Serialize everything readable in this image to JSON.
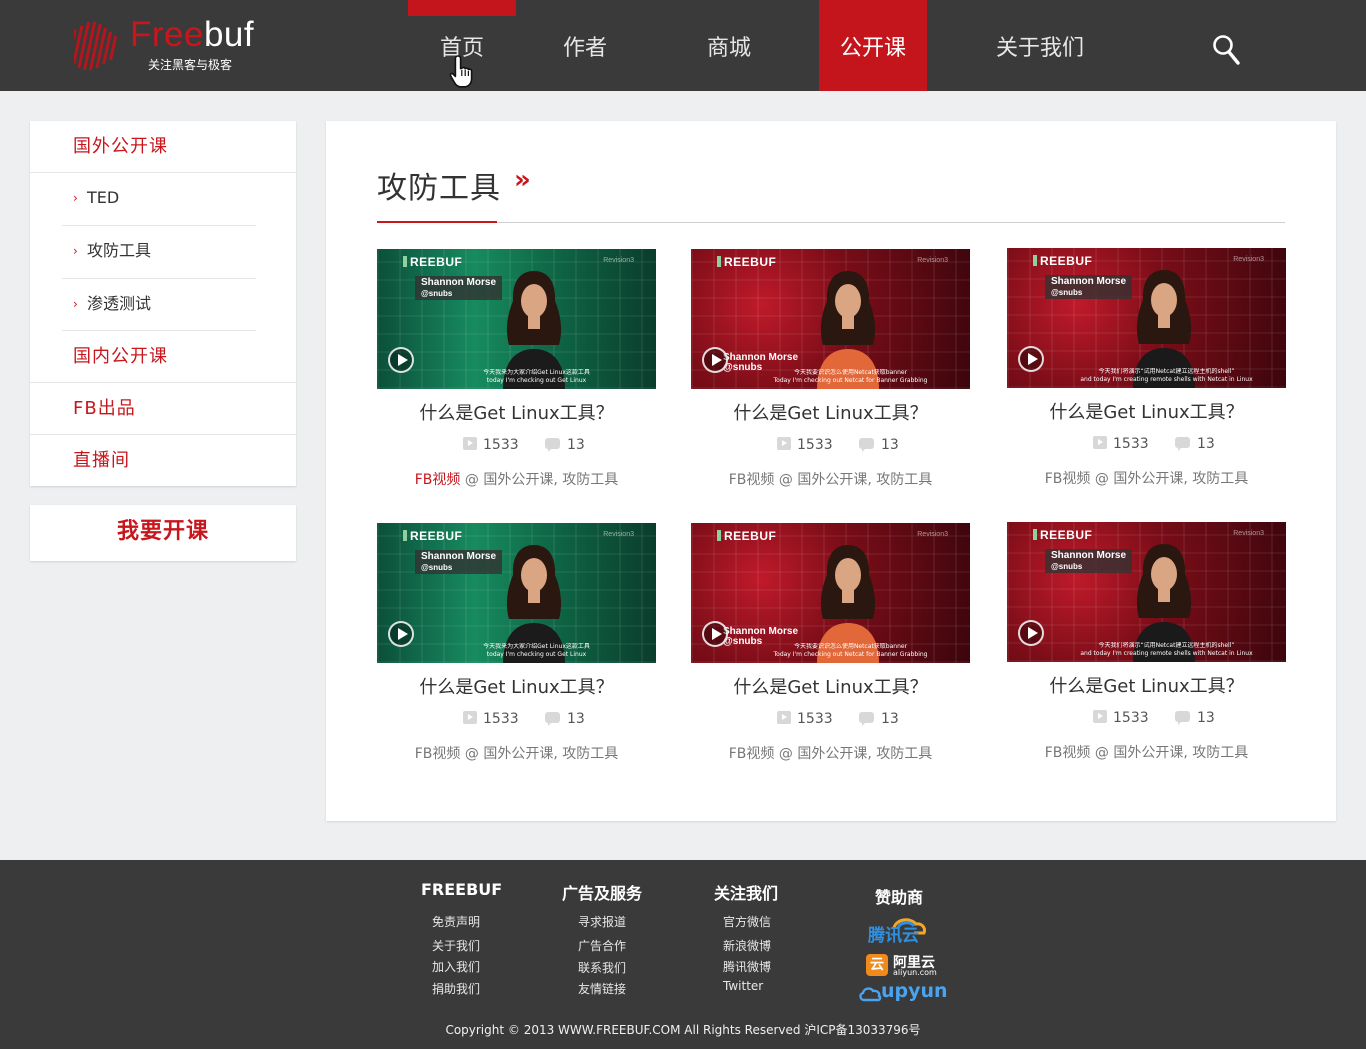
{
  "header": {
    "logo": {
      "word_red": "Free",
      "word_white": "buf",
      "tagline": "关注黑客与极客"
    },
    "nav": [
      {
        "label": "首页"
      },
      {
        "label": "作者"
      },
      {
        "label": "商城"
      },
      {
        "label": "公开课"
      },
      {
        "label": "关于我们"
      }
    ],
    "active_nav": "公开课",
    "search_icon": "search-icon"
  },
  "sidebar": {
    "categories": [
      {
        "label": "国外公开课"
      },
      {
        "label": "国内公开课"
      },
      {
        "label": "FB出品"
      },
      {
        "label": "直播间"
      }
    ],
    "subitems": [
      {
        "label": "TED"
      },
      {
        "label": "攻防工具"
      },
      {
        "label": "渗透测试"
      }
    ],
    "open_course_button": "我要开课"
  },
  "main": {
    "section_title": "攻防工具",
    "section_arrow": "»",
    "cards": [
      {
        "title": "什么是Get Linux工具？",
        "views": "1533",
        "comments": "13",
        "source": "FB视频",
        "tags": "@ 国外公开课, 攻防工具",
        "thumb": {
          "style": "green",
          "brand": "REEBUF",
          "name": "Shannon Morse",
          "handle": "@snubs",
          "rev": "Revision3",
          "subtitle_cn": "今天我来为大家介绍Get Linux这款工具",
          "subtitle_en": "today I'm checking out Get Linux"
        }
      },
      {
        "title": "什么是Get Linux工具？",
        "views": "1533",
        "comments": "13",
        "source": "FB视频",
        "tags": "@ 国外公开课, 攻防工具",
        "thumb": {
          "style": "red",
          "brand": "REEBUF",
          "name": "Shannon Morse",
          "handle": "@snubs",
          "rev": "Revision3",
          "subtitle_cn": "今天我要识识怎么使用Netcat获取banner",
          "subtitle_en": "Today I'm checking out Netcat for Banner Grabbing"
        }
      },
      {
        "title": "什么是Get Linux工具？",
        "views": "1533",
        "comments": "13",
        "source": "FB视频",
        "tags": "@ 国外公开课, 攻防工具",
        "thumb": {
          "style": "red",
          "brand": "REEBUF",
          "name": "Shannon Morse",
          "handle": "@snubs",
          "rev": "Revision3",
          "subtitle_cn": "今天我们将演示“试用Netcat建立远程主机的shell”",
          "subtitle_en": "and today I'm creating remote shells with Netcat in Linux"
        }
      },
      {
        "title": "什么是Get Linux工具？",
        "views": "1533",
        "comments": "13",
        "source": "FB视频",
        "tags": "@ 国外公开课, 攻防工具",
        "thumb": {
          "style": "green",
          "brand": "REEBUF",
          "name": "Shannon Morse",
          "handle": "@snubs",
          "rev": "Revision3",
          "subtitle_cn": "今天我来为大家介绍Get Linux这款工具",
          "subtitle_en": "today I'm checking out Get Linux"
        }
      },
      {
        "title": "什么是Get Linux工具？",
        "views": "1533",
        "comments": "13",
        "source": "FB视频",
        "tags": "@ 国外公开课, 攻防工具",
        "thumb": {
          "style": "red",
          "brand": "REEBUF",
          "name": "Shannon Morse",
          "handle": "@snubs",
          "rev": "Revision3",
          "subtitle_cn": "今天我要识识怎么使用Netcat获取banner",
          "subtitle_en": "Today I'm checking out Netcat for Banner Grabbing"
        }
      },
      {
        "title": "什么是Get Linux工具？",
        "views": "1533",
        "comments": "13",
        "source": "FB视频",
        "tags": "@ 国外公开课, 攻防工具",
        "thumb": {
          "style": "red",
          "brand": "REEBUF",
          "name": "Shannon Morse",
          "handle": "@snubs",
          "rev": "Revision3",
          "subtitle_cn": "今天我们将演示“试用Netcat建立远程主机的shell”",
          "subtitle_en": "and today I'm creating remote shells with Netcat in Linux"
        }
      }
    ]
  },
  "footer": {
    "columns": [
      {
        "heading": "FREEBUF",
        "links": [
          "免责声明",
          "关于我们",
          "加入我们",
          "捐助我们"
        ]
      },
      {
        "heading": "广告及服务",
        "links": [
          "寻求报道",
          "广告合作",
          "联系我们",
          "友情链接"
        ]
      },
      {
        "heading": "关注我们",
        "links": [
          "官方微信",
          "新浪微博",
          "腾讯微博",
          "Twitter"
        ]
      }
    ],
    "sponsors_heading": "赞助商",
    "sponsors": {
      "tencent": "腾讯云",
      "aliyun_cn": "阿里云",
      "aliyun_en": "aliyun.com",
      "upyun": "upyun"
    },
    "copyright": "Copyright © 2013 WWW.FREEBUF.COM All Rights Reserved 沪ICP备13033796号"
  },
  "colors": {
    "brand_red": "#c8161d",
    "header_bg": "#3a3a3a",
    "page_bg": "#eeeff0"
  }
}
